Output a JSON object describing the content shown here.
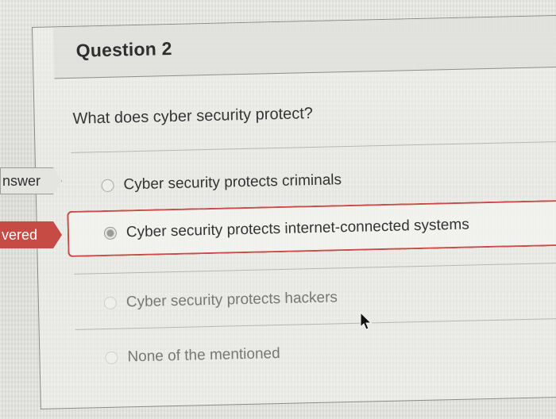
{
  "question": {
    "title": "Question 2",
    "text": "What does cyber security protect?"
  },
  "side_tags": {
    "correct_answer": "nswer",
    "answered": "vered"
  },
  "options": [
    {
      "label": "Cyber security protects criminals",
      "selected": false
    },
    {
      "label": "Cyber security protects internet-connected systems",
      "selected": true
    },
    {
      "label": "Cyber security protects hackers",
      "selected": false
    },
    {
      "label": "None of the mentioned",
      "selected": false
    }
  ],
  "colors": {
    "accent_red": "#c94a46",
    "tag_red": "#c54b44",
    "page_bg": "#dcdcd6"
  },
  "icons": {
    "cursor": "mouse-pointer-icon",
    "radio": "radio-icon"
  }
}
